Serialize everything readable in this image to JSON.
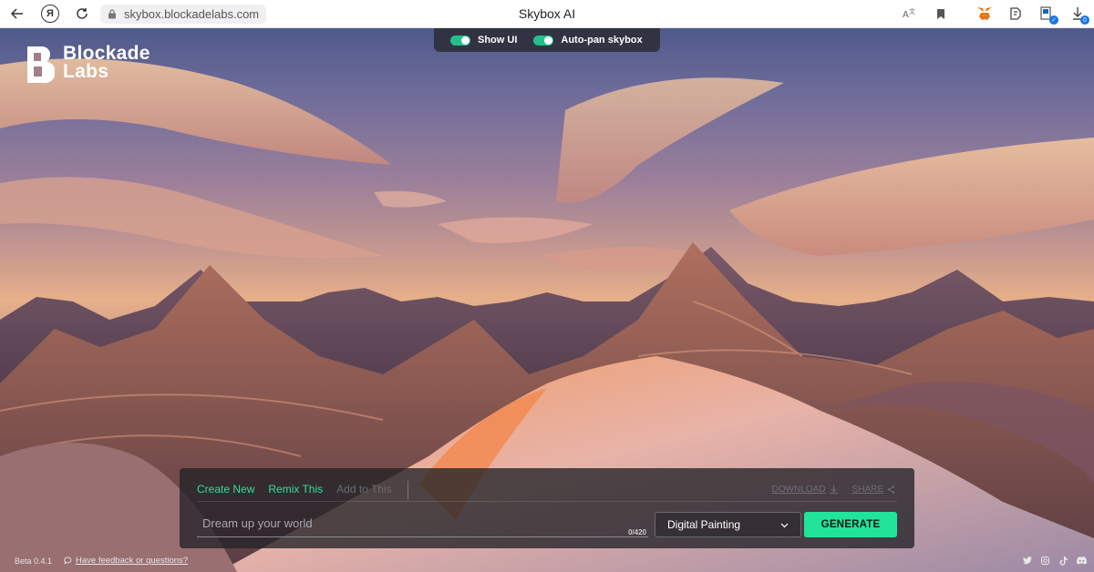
{
  "browser": {
    "url": "skybox.blockadelabs.com",
    "title": "Skybox AI",
    "ya_label": "Я",
    "download_badge": "0"
  },
  "toggles": {
    "show_ui": {
      "label": "Show UI",
      "on": true
    },
    "auto_pan": {
      "label": "Auto-pan skybox",
      "on": true
    }
  },
  "logo": {
    "line1": "Blockade",
    "line2": "Labs"
  },
  "panel": {
    "tabs": [
      "Create New",
      "Remix This",
      "Add to This"
    ],
    "download_label": "DOWNLOAD",
    "share_label": "SHARE",
    "prompt_placeholder": "Dream up your world",
    "char_count": "0/420",
    "style_value": "Digital Painting",
    "generate_label": "GENERATE"
  },
  "footer": {
    "beta": "Beta 0.4.1",
    "feedback": "Have feedback or questions?"
  },
  "colors": {
    "accent": "#21e49a",
    "tab_active": "#2fe09b",
    "panel_bg": "#232228"
  },
  "icons": [
    "back-icon",
    "refresh-icon",
    "lock-icon",
    "translate-icon",
    "bookmark-icon",
    "metamask-icon",
    "extension-icon",
    "profile-icon",
    "download-icon",
    "chevron-down-icon",
    "twitter-icon",
    "instagram-icon",
    "tiktok-icon",
    "discord-icon",
    "chat-icon",
    "share-icon"
  ]
}
